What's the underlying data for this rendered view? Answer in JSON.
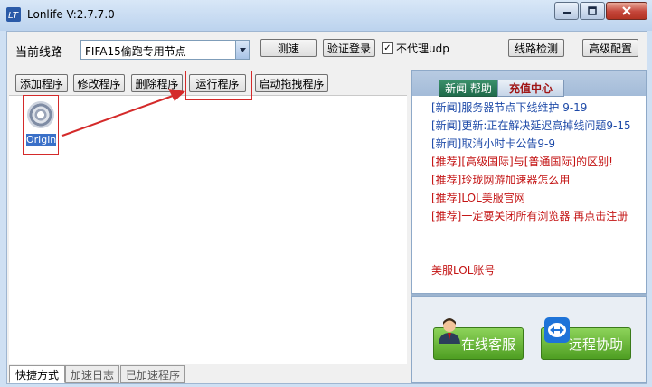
{
  "window": {
    "title": "Lonlife V:2.7.7.0",
    "controls": [
      "minimize",
      "maximize",
      "close"
    ]
  },
  "toolbar": {
    "route_label": "当前线路",
    "route_value": "FIFA15偷跑专用节点",
    "speed_test_label": "测速",
    "verify_login_label": "验证登录",
    "no_proxy_udp_label": "不代理udp",
    "no_proxy_udp_checked": true,
    "route_check_label": "线路检测",
    "advanced_config_label": "高级配置"
  },
  "program_toolbar": {
    "add_label": "添加程序",
    "edit_label": "修改程序",
    "delete_label": "删除程序",
    "run_label": "运行程序",
    "start_drag_label": "启动拖拽程序"
  },
  "programs": [
    {
      "label": "Origin",
      "icon": "origin-icon"
    }
  ],
  "bottom_tabs": [
    "快捷方式",
    "加速日志",
    "已加速程序"
  ],
  "news_panel": {
    "tabs": [
      "新闻 帮助",
      "充值中心"
    ],
    "items": [
      {
        "tag": "[新闻]",
        "text": "服务器节点下线维护  9-19",
        "kind": "notice"
      },
      {
        "tag": "[新闻]",
        "text": "更新:正在解决延迟高掉线问题9-15",
        "kind": "notice"
      },
      {
        "tag": "[新闻]",
        "text": "取消小时卡公告9-9",
        "kind": "notice"
      },
      {
        "tag": "[推荐]",
        "text": "[高级国际]与[普通国际]的区别!",
        "kind": "promo"
      },
      {
        "tag": "[推荐]",
        "text": "玲珑网游加速器怎么用",
        "kind": "promo"
      },
      {
        "tag": "[推荐]",
        "text": "LOL美服官网",
        "kind": "promo"
      },
      {
        "tag": "[推荐]",
        "text": "一定要关闭所有浏览器 再点击注册",
        "kind": "promo"
      }
    ],
    "continuation": "美服LOL账号"
  },
  "support": {
    "online_service_label": "在线客服",
    "remote_assist_label": "远程协助"
  },
  "colors": {
    "annotation_red": "#d42a2a",
    "news_blue": "#1e4aa8",
    "promo_red": "#c41414",
    "button_green": "#4e9e22"
  }
}
